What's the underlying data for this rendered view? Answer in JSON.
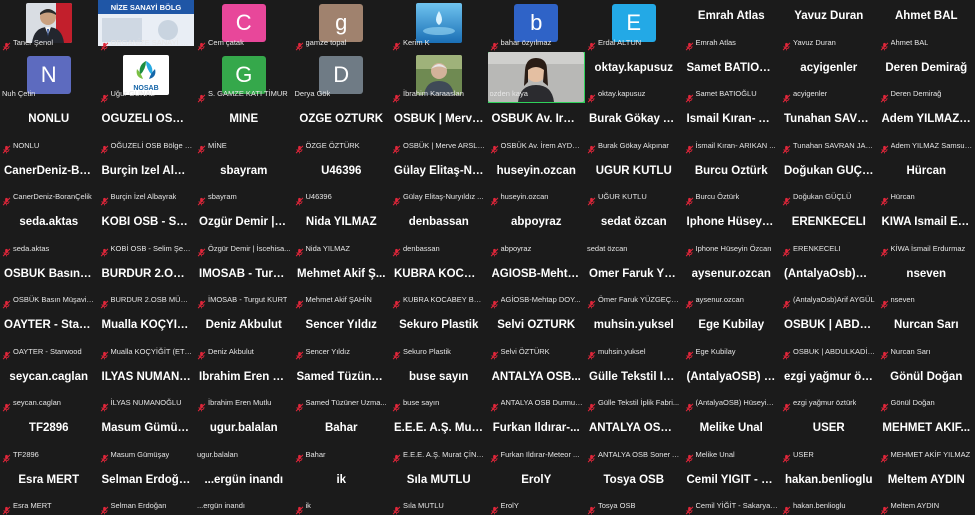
{
  "colors": {
    "background": "#1b1b1b",
    "speaking_border": "#2fd25a",
    "mute_red": "#e0263a",
    "text_main": "#ffffff",
    "text_sub": "#e6e6e6"
  },
  "participants": [
    {
      "label": "Taner Şenol",
      "display": "photo",
      "photo_kind": "man-suit",
      "muted": true
    },
    {
      "label": "ORGANİZE SANAYİ BÖ...",
      "display": "banner",
      "banner_text": "NİZE SANAYİ BÖLG",
      "muted": true
    },
    {
      "label": "Cem çatak",
      "display": "letter",
      "letter": "C",
      "avatar_color": "#e8479a",
      "muted": true
    },
    {
      "label": "gamze topal",
      "display": "letter",
      "letter": "g",
      "avatar_color": "#a0826e",
      "muted": true
    },
    {
      "label": "Kerim K",
      "display": "photo",
      "photo_kind": "water-drop",
      "muted": true
    },
    {
      "label": "bahar özyılmaz",
      "display": "letter",
      "letter": "b",
      "avatar_color": "#2f63c7",
      "muted": true
    },
    {
      "label": "Erdal ALTUN",
      "display": "letter",
      "letter": "E",
      "avatar_color": "#23a9e6",
      "muted": true
    },
    {
      "label": "Emrah Atlas",
      "display": "name",
      "name": "Emrah Atlas",
      "muted": true
    },
    {
      "label": "Yavuz Duran",
      "display": "name",
      "name": "Yavuz Duran",
      "muted": true
    },
    {
      "label": "Ahmet BAL",
      "display": "name",
      "name": "Ahmet BAL",
      "muted": true
    },
    {
      "label": "Nuh Çetin",
      "display": "letter",
      "letter": "N",
      "avatar_color": "#5d6bbf",
      "muted": false
    },
    {
      "label": "Uğur GUNAL",
      "display": "photo",
      "photo_kind": "nosab-logo",
      "logo_text": "NOSAB",
      "muted": true
    },
    {
      "label": "S. GAMZE KATI TİMUR",
      "display": "letter",
      "letter": "G",
      "avatar_color": "#35a84b",
      "muted": true
    },
    {
      "label": "Derya Gök",
      "display": "letter",
      "letter": "D",
      "avatar_color": "#6f7b85",
      "muted": false
    },
    {
      "label": "İbrahim Karaaslan",
      "display": "photo",
      "photo_kind": "old-man",
      "muted": true
    },
    {
      "label": "ozden kaya",
      "display": "photo",
      "photo_kind": "woman-video",
      "muted": false,
      "speaking": true
    },
    {
      "label": "oktay.kapusuz",
      "display": "name",
      "name": "oktay.kapusuz",
      "muted": true
    },
    {
      "label": "Samet BATIOĞLU",
      "display": "name",
      "name": "Samet BATIOĞLU",
      "muted": true
    },
    {
      "label": "acyigenler",
      "display": "name",
      "name": "acyigenler",
      "muted": true
    },
    {
      "label": "Deren Demirağ",
      "display": "name",
      "name": "Deren Demirağ",
      "muted": true
    },
    {
      "label": "NONLU",
      "display": "name",
      "name": "NONLU",
      "muted": true
    },
    {
      "label": "OĞUZELİ OSB Bölge M...",
      "display": "name",
      "name": "OĞUZELİ OSB B...",
      "muted": true
    },
    {
      "label": "MİNE",
      "display": "name",
      "name": "MİNE",
      "muted": true
    },
    {
      "label": "ÖZGE ÖZTÜRK",
      "display": "name",
      "name": "ÖZGE ÖZTÜRK",
      "muted": true
    },
    {
      "label": "OSBÜK | Merve ARSLA...",
      "display": "name",
      "name": "OSBÜK | Merve...",
      "muted": true
    },
    {
      "label": "OSBÜK Av. İrem AYDO...",
      "display": "name",
      "name": "OSBÜK Av. İrem...",
      "muted": true
    },
    {
      "label": "Burak Gökay Akpınar",
      "display": "name",
      "name": "Burak Gökay Ak...",
      "muted": true
    },
    {
      "label": "İsmail Kıran- ARIKAN ...",
      "display": "name",
      "name": "İsmail Kıran- AR...",
      "muted": true
    },
    {
      "label": "Tunahan SAVRAN JAN...",
      "display": "name",
      "name": "Tunahan SAVRA...",
      "muted": true
    },
    {
      "label": "Adem YILMAZ Samsun...",
      "display": "name",
      "name": "Adem YILMAZ S...",
      "muted": true
    },
    {
      "label": "CanerDeniz-BoranÇelik",
      "display": "name",
      "name": "CanerDeniz-Bor...",
      "muted": true
    },
    {
      "label": "Burçin İzel Albayrak",
      "display": "name",
      "name": "Burçin İzel Alba...",
      "muted": true
    },
    {
      "label": "sbayram",
      "display": "name",
      "name": "sbayram",
      "muted": true
    },
    {
      "label": "U46396",
      "display": "name",
      "name": "U46396",
      "muted": true
    },
    {
      "label": "Gülay Elitaş-Nuryıldız ...",
      "display": "name",
      "name": "Gülay Elitaş-Nu...",
      "muted": true
    },
    {
      "label": "huseyin.ozcan",
      "display": "name",
      "name": "huseyin.ozcan",
      "muted": true
    },
    {
      "label": "UĞUR KUTLU",
      "display": "name",
      "name": "UĞUR KUTLU",
      "muted": true
    },
    {
      "label": "Burcu Öztürk",
      "display": "name",
      "name": "Burcu Öztürk",
      "muted": true
    },
    {
      "label": "Doğukan GÜÇLÜ",
      "display": "name",
      "name": "Doğukan GÜÇLÜ",
      "muted": true
    },
    {
      "label": "Hürcan",
      "display": "name",
      "name": "Hürcan",
      "muted": true
    },
    {
      "label": "seda.aktas",
      "display": "name",
      "name": "seda.aktas",
      "muted": true
    },
    {
      "label": "KOBİ OSB - Selim Şent...",
      "display": "name",
      "name": "KOBİ OSB - Seli...",
      "muted": true
    },
    {
      "label": "Özgür Demir | İscehisa...",
      "display": "name",
      "name": "Özgür Demir | İ...",
      "muted": true
    },
    {
      "label": "Nida YILMAZ",
      "display": "name",
      "name": "Nida YILMAZ",
      "muted": true
    },
    {
      "label": "denbassan",
      "display": "name",
      "name": "denbassan",
      "muted": true
    },
    {
      "label": "abpoyraz",
      "display": "name",
      "name": "abpoyraz",
      "muted": true
    },
    {
      "label": "sedat özcan",
      "display": "name",
      "name": "sedat özcan",
      "muted": false
    },
    {
      "label": "Iphone Hüseyin Özcan",
      "display": "name",
      "name": "Iphone Hüseyin...",
      "muted": true
    },
    {
      "label": "ERENKECELI",
      "display": "name",
      "name": "ERENKECELI",
      "muted": true
    },
    {
      "label": "KİWA İsmail Erdurmaz",
      "display": "name",
      "name": "KİWA İsmail Erd...",
      "muted": true
    },
    {
      "label": "OSBÜK Basın Müşaviri...",
      "display": "name",
      "name": "OSBÜK Basın M...",
      "muted": true
    },
    {
      "label": "BURDUR 2.OSB MÜDÜ...",
      "display": "name",
      "name": "BURDUR 2.OSB...",
      "muted": true
    },
    {
      "label": "İMOSAB - Turgut KURT",
      "display": "name",
      "name": "İMOSAB - Turg...",
      "muted": true
    },
    {
      "label": "Mehmet Akif ŞAHİN",
      "display": "name",
      "name": "Mehmet Akif Ş...",
      "muted": true
    },
    {
      "label": "KUBRA KOCABEY BETA...",
      "display": "name",
      "name": "KUBRA KOCABE...",
      "muted": true
    },
    {
      "label": "AGİOSB-Mehtap DOY...",
      "display": "name",
      "name": "AGİOSB-Mehta...",
      "muted": true
    },
    {
      "label": "Ömer Faruk YÜZGEÇ -...",
      "display": "name",
      "name": "Ömer Faruk YÜ...",
      "muted": true
    },
    {
      "label": "aysenur.ozcan",
      "display": "name",
      "name": "aysenur.ozcan",
      "muted": true
    },
    {
      "label": "(AntalyaOsb)Arif AYGÜL",
      "display": "name",
      "name": "(AntalyaOsb)Ari...",
      "muted": true
    },
    {
      "label": "nseven",
      "display": "name",
      "name": "nseven",
      "muted": true
    },
    {
      "label": "OAYTER - Starwood",
      "display": "name",
      "name": "OAYTER - Starw...",
      "muted": true
    },
    {
      "label": "Mualla KOÇYİĞİT (ETK...",
      "display": "name",
      "name": "Mualla KOÇYİĞİ...",
      "muted": true
    },
    {
      "label": "Deniz Akbulut",
      "display": "name",
      "name": "Deniz Akbulut",
      "muted": true
    },
    {
      "label": "Sencer Yıldız",
      "display": "name",
      "name": "Sencer Yıldız",
      "muted": true
    },
    {
      "label": "Sekuro Plastik",
      "display": "name",
      "name": "Sekuro Plastik",
      "muted": true
    },
    {
      "label": "Selvi ÖZTÜRK",
      "display": "name",
      "name": "Selvi ÖZTÜRK",
      "muted": true
    },
    {
      "label": "muhsin.yuksel",
      "display": "name",
      "name": "muhsin.yuksel",
      "muted": true
    },
    {
      "label": "Ege Kubilay",
      "display": "name",
      "name": "Ege Kubilay",
      "muted": true
    },
    {
      "label": "OSBUK | ABDULKADİR ...",
      "display": "name",
      "name": "OSBUK | ABDUL...",
      "muted": true
    },
    {
      "label": "Nurcan Sarı",
      "display": "name",
      "name": "Nurcan Sarı",
      "muted": true
    },
    {
      "label": "seycan.caglan",
      "display": "name",
      "name": "seycan.caglan",
      "muted": true
    },
    {
      "label": "İLYAS NUMANOĞLU",
      "display": "name",
      "name": "İLYAS NUMANO...",
      "muted": true
    },
    {
      "label": "İbrahim Eren Mutlu",
      "display": "name",
      "name": "İbrahim Eren M...",
      "muted": true
    },
    {
      "label": "Samed Tüzüner Uzma...",
      "display": "name",
      "name": "Samed Tüzüner...",
      "muted": true
    },
    {
      "label": "buse sayın",
      "display": "name",
      "name": "buse sayın",
      "muted": true
    },
    {
      "label": "ANTALYA OSB Durmuş...",
      "display": "name",
      "name": "ANTALYA OSB...",
      "muted": true
    },
    {
      "label": "Gülle Tekstil İplik Fabri...",
      "display": "name",
      "name": "Gülle Tekstil İpli...",
      "muted": true
    },
    {
      "label": "(AntalyaOSB) Hüseyin ...",
      "display": "name",
      "name": "(AntalyaOSB) H...",
      "muted": true
    },
    {
      "label": "ezgi yağmur öztürk",
      "display": "name",
      "name": "ezgi yağmur özt...",
      "muted": true
    },
    {
      "label": "Gönül Doğan",
      "display": "name",
      "name": "Gönül Doğan",
      "muted": true
    },
    {
      "label": "TF2896",
      "display": "name",
      "name": "TF2896",
      "muted": true
    },
    {
      "label": "Masum Gümüşay",
      "display": "name",
      "name": "Masum Gümüşay",
      "muted": true
    },
    {
      "label": "ugur.balalan",
      "display": "name",
      "name": "ugur.balalan",
      "muted": false
    },
    {
      "label": "Bahar",
      "display": "name",
      "name": "Bahar",
      "muted": true
    },
    {
      "label": "E.E.E. A.Ş. Murat ÇİNİTAŞ",
      "display": "name",
      "name": "E.E.E. A.Ş. Mura...",
      "muted": true
    },
    {
      "label": "Furkan Ildırar-Meteor ...",
      "display": "name",
      "name": "Furkan Ildırar-...",
      "muted": true
    },
    {
      "label": "ANTALYA OSB Soner A...",
      "display": "name",
      "name": "ANTALYA OSB S...",
      "muted": true
    },
    {
      "label": "Melike Unal",
      "display": "name",
      "name": "Melike Unal",
      "muted": true
    },
    {
      "label": "USER",
      "display": "name",
      "name": "USER",
      "muted": true
    },
    {
      "label": "MEHMET AKİF YILMAZ",
      "display": "name",
      "name": "MEHMET AKİF...",
      "muted": true
    },
    {
      "label": "Esra MERT",
      "display": "name",
      "name": "Esra MERT",
      "muted": true
    },
    {
      "label": "Selman Erdoğan",
      "display": "name",
      "name": "Selman Erdoğan",
      "muted": true
    },
    {
      "label": "...ergün inandı",
      "display": "name",
      "name": "...ergün inandı",
      "muted": false
    },
    {
      "label": "ik",
      "display": "name",
      "name": "ik",
      "muted": true
    },
    {
      "label": "Sıla MUTLU",
      "display": "name",
      "name": "Sıla MUTLU",
      "muted": true
    },
    {
      "label": "ErolY",
      "display": "name",
      "name": "ErolY",
      "muted": true
    },
    {
      "label": "Tosya OSB",
      "display": "name",
      "name": "Tosya OSB",
      "muted": true
    },
    {
      "label": "Cemil YİĞİT - Sakarya ...",
      "display": "name",
      "name": "Cemil YİĞİT - Sa...",
      "muted": true
    },
    {
      "label": "hakan.benlioglu",
      "display": "name",
      "name": "hakan.benlioglu",
      "muted": true
    },
    {
      "label": "Meltem AYDIN",
      "display": "name",
      "name": "Meltem AYDIN",
      "muted": true
    }
  ]
}
